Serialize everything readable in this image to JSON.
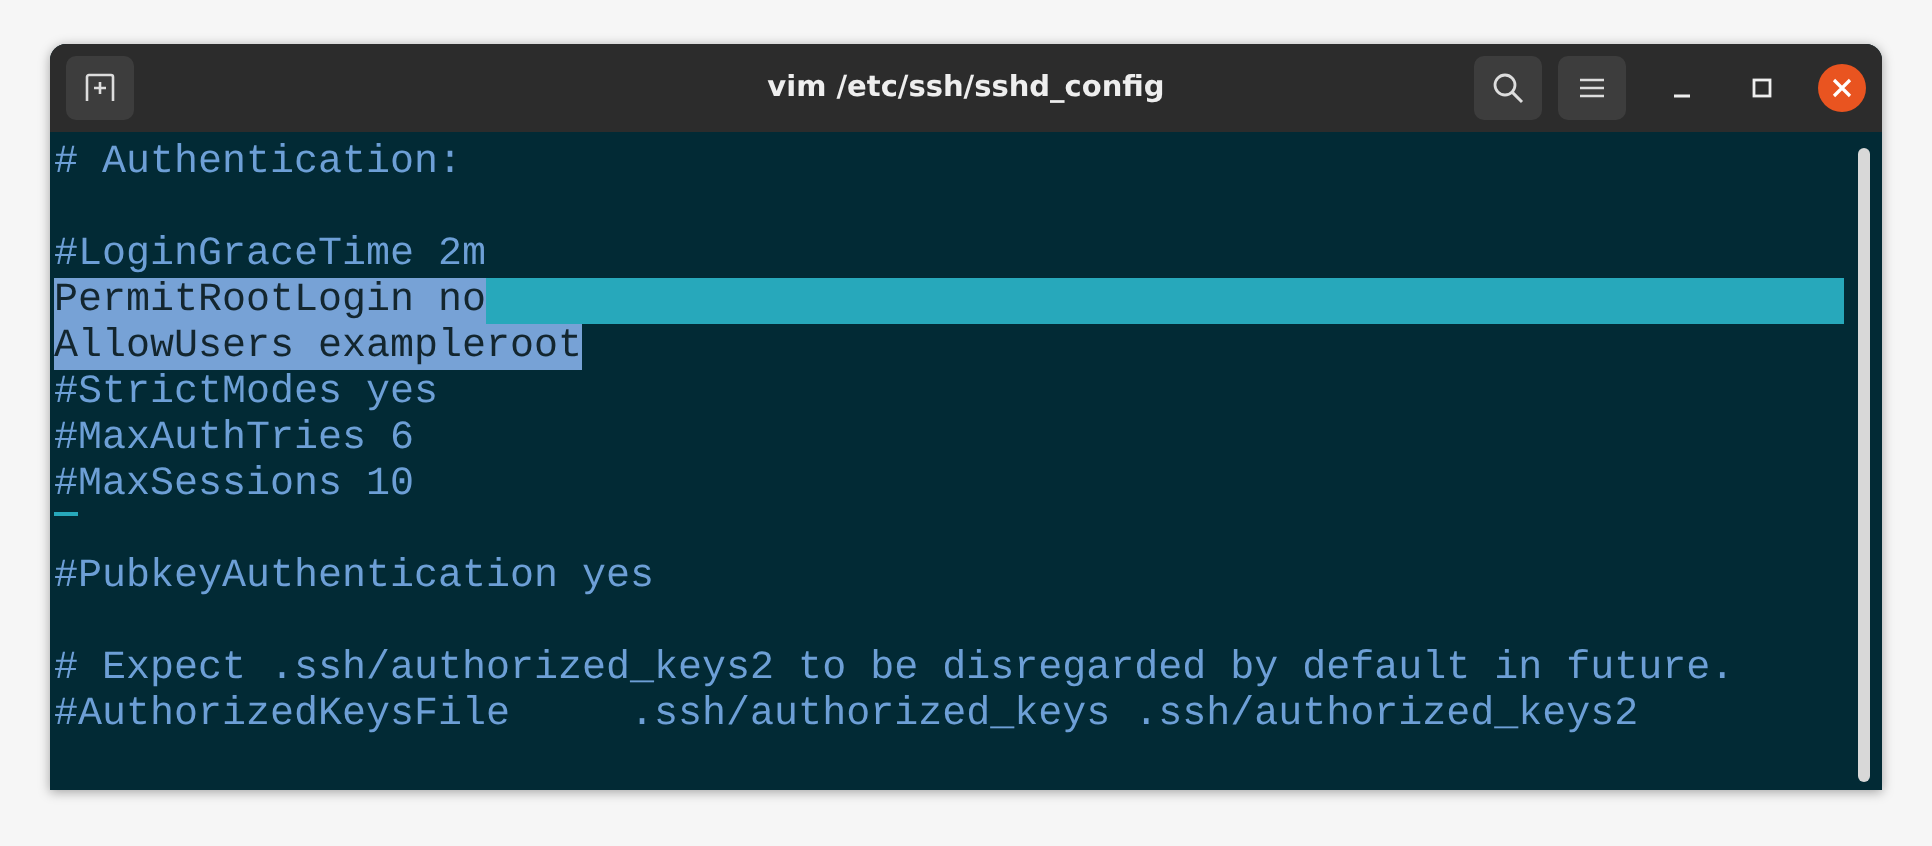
{
  "window": {
    "title": "vim /etc/ssh/sshd_config"
  },
  "editor": {
    "lines": [
      {
        "kind": "text",
        "text": "# Authentication:",
        "selected": false,
        "cursorline": false
      },
      {
        "kind": "blank",
        "selected": false,
        "cursorline": false
      },
      {
        "kind": "text",
        "text": "#LoginGraceTime 2m",
        "selected": false,
        "cursorline": false
      },
      {
        "kind": "text",
        "text": "PermitRootLogin no",
        "selected": true,
        "cursorline": true
      },
      {
        "kind": "text",
        "text": "AllowUsers exampleroot",
        "selected": true,
        "cursorline": false
      },
      {
        "kind": "text",
        "text": "#StrictModes yes",
        "selected": false,
        "cursorline": false
      },
      {
        "kind": "text",
        "text": "#MaxAuthTries 6",
        "selected": false,
        "cursorline": false
      },
      {
        "kind": "text",
        "text": "#MaxSessions 10",
        "selected": false,
        "cursorline": false
      },
      {
        "kind": "cursor",
        "selected": false,
        "cursorline": false
      },
      {
        "kind": "text",
        "text": "#PubkeyAuthentication yes",
        "selected": false,
        "cursorline": false
      },
      {
        "kind": "blank",
        "selected": false,
        "cursorline": false
      },
      {
        "kind": "text",
        "text": "# Expect .ssh/authorized_keys2 to be disregarded by default in future.",
        "selected": false,
        "cursorline": false
      },
      {
        "kind": "text",
        "text": "#AuthorizedKeysFile     .ssh/authorized_keys .ssh/authorized_keys2",
        "selected": false,
        "cursorline": false
      }
    ]
  }
}
